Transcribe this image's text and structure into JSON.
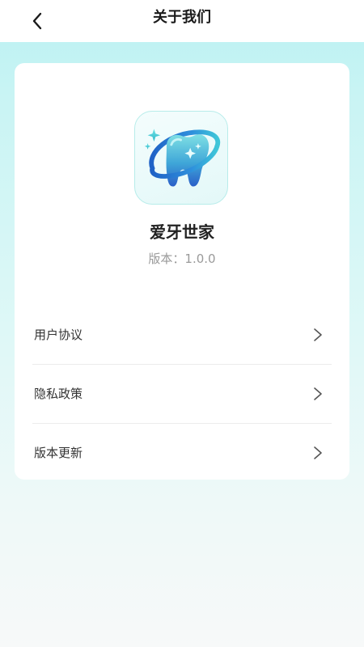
{
  "header": {
    "back_icon": "chevron-left-icon",
    "title": "关于我们"
  },
  "app": {
    "icon": "tooth-logo-icon",
    "name": "爱牙世家",
    "version_label": "版本：1.0.0"
  },
  "menu": {
    "items": [
      {
        "label": "用户协议",
        "icon": "chevron-right-icon"
      },
      {
        "label": "隐私政策",
        "icon": "chevron-right-icon"
      },
      {
        "label": "版本更新",
        "icon": "chevron-right-icon"
      }
    ]
  },
  "colors": {
    "background_top": "#b9f1f2",
    "background_bottom": "#f7f9f9",
    "card": "#ffffff",
    "accent_teal": "#37c5d4",
    "accent_blue": "#2a78d8"
  }
}
